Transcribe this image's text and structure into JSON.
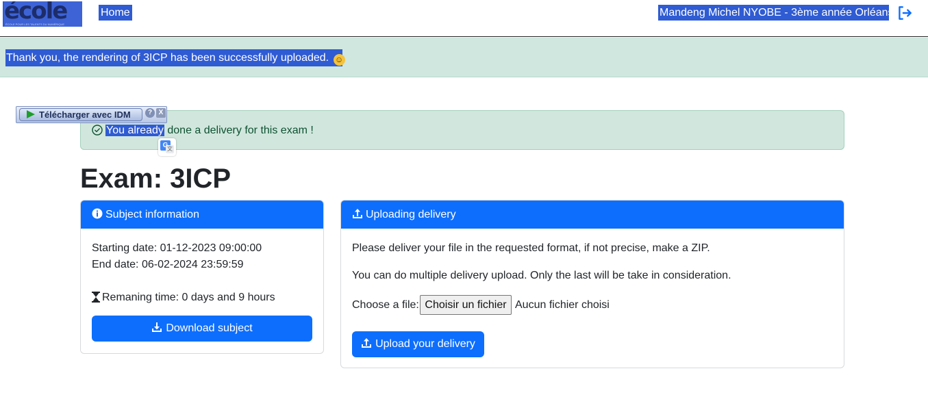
{
  "nav": {
    "logo_text": "école iT",
    "logo_tagline": "ÉCOLE POUR LES TALENTS DU NUMÉRIQUE",
    "home_label": "Home",
    "user_label": "Mandeng Michel NYOBE - 3ème année Orléans",
    "logout_icon": "logout-icon"
  },
  "flash": {
    "message": "Thank you, the rendering of 3ICP has been successfully uploaded.",
    "emoji": "☺"
  },
  "idm": {
    "button_label": "Télécharger avec IDM",
    "help": "?",
    "close": "X"
  },
  "alert": {
    "selected_text": "You already",
    "rest_text": " done a delivery for this exam !"
  },
  "translate_icon": {
    "main": "G",
    "sub": "文"
  },
  "page": {
    "title": "Exam: 3ICP"
  },
  "subject_card": {
    "header": "Subject information",
    "starting_date": "Starting date: 01-12-2023 09:00:00",
    "end_date": "End date: 06-02-2024 23:59:59",
    "remaining_time": "Remaning time: 0 days and 9 hours",
    "download_button": "Download subject"
  },
  "upload_card": {
    "header": "Uploading delivery",
    "instructions": "Please deliver your file in the requested format, if not precise, make a ZIP.",
    "multiple_note": "You can do multiple delivery upload. Only the last will be take in consideration.",
    "choose_label": "Choose a file:",
    "file_button": "Choisir un fichier",
    "file_status": "Aucun fichier choisi",
    "upload_button": "Upload your delivery"
  },
  "colors": {
    "primary": "#0d6efd",
    "selection": "#2f5bd3",
    "success_bg": "#d1e7dd",
    "success_text": "#0f5132"
  }
}
